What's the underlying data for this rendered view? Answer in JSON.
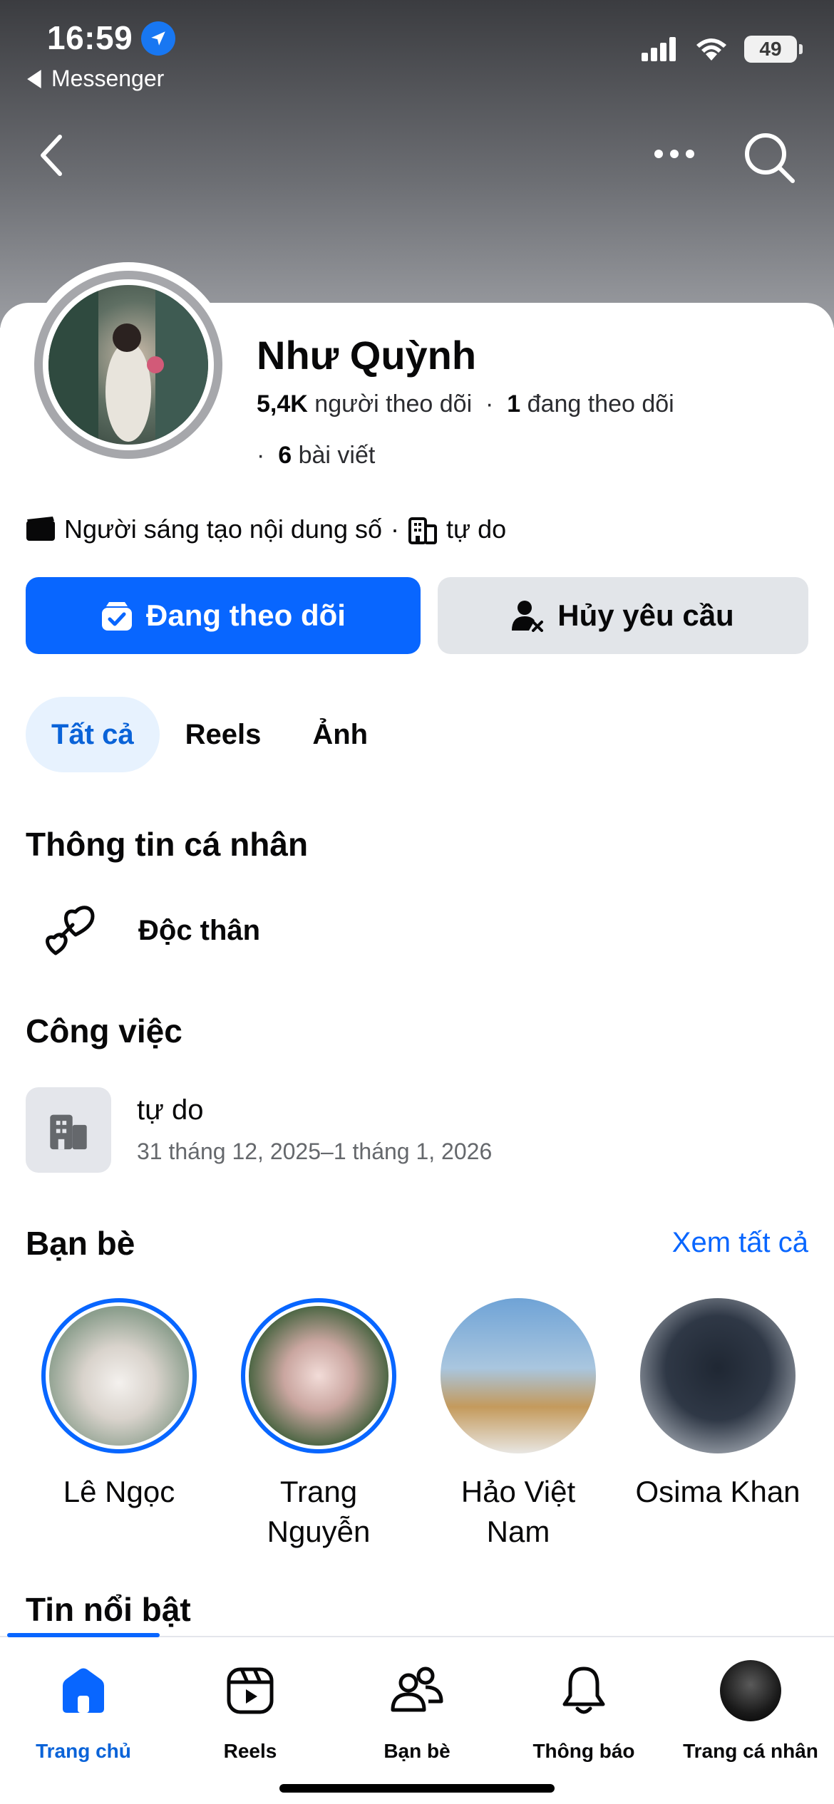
{
  "status_bar": {
    "time": "16:59",
    "back_app": "Messenger",
    "battery": "49"
  },
  "profile": {
    "name": "Như Quỳnh",
    "followers_count": "5,4K",
    "followers_label": "người theo dõi",
    "following_count": "1",
    "following_label": "đang theo dõi",
    "posts_count": "6",
    "posts_label": "bài viết",
    "category": "Người sáng tạo nội dung số",
    "workplace": "tự do"
  },
  "actions": {
    "following_button": "Đang theo dõi",
    "cancel_request_button": "Hủy yêu cầu"
  },
  "tabs": [
    {
      "label": "Tất cả",
      "active": true
    },
    {
      "label": "Reels",
      "active": false
    },
    {
      "label": "Ảnh",
      "active": false
    }
  ],
  "personal_info": {
    "title": "Thông tin cá nhân",
    "relationship": "Độc thân"
  },
  "work": {
    "title": "Công việc",
    "place": "tự do",
    "dates": "31 tháng 12, 2025–1 tháng 1, 2026"
  },
  "friends": {
    "title": "Bạn bè",
    "see_all": "Xem tất cả",
    "items": [
      {
        "name": "Lê Ngọc",
        "has_story": true
      },
      {
        "name": "Trang Nguyễn",
        "has_story": true
      },
      {
        "name": "Hảo Việt Nam",
        "has_story": false
      },
      {
        "name": "Osima Khan",
        "has_story": false
      }
    ]
  },
  "highlights": {
    "title": "Tin nổi bật"
  },
  "bottom_nav": [
    {
      "label": "Trang chủ",
      "icon": "home-icon",
      "active": true
    },
    {
      "label": "Reels",
      "icon": "reels-icon",
      "active": false
    },
    {
      "label": "Bạn bè",
      "icon": "friends-icon",
      "active": false
    },
    {
      "label": "Thông báo",
      "icon": "bell-icon",
      "active": false
    },
    {
      "label": "Trang cá nhân",
      "icon": "profile-avatar",
      "active": false
    }
  ],
  "colors": {
    "accent": "#0866ff",
    "active_tab_bg": "#e7f2fe",
    "secondary_button": "#e2e5e9"
  }
}
